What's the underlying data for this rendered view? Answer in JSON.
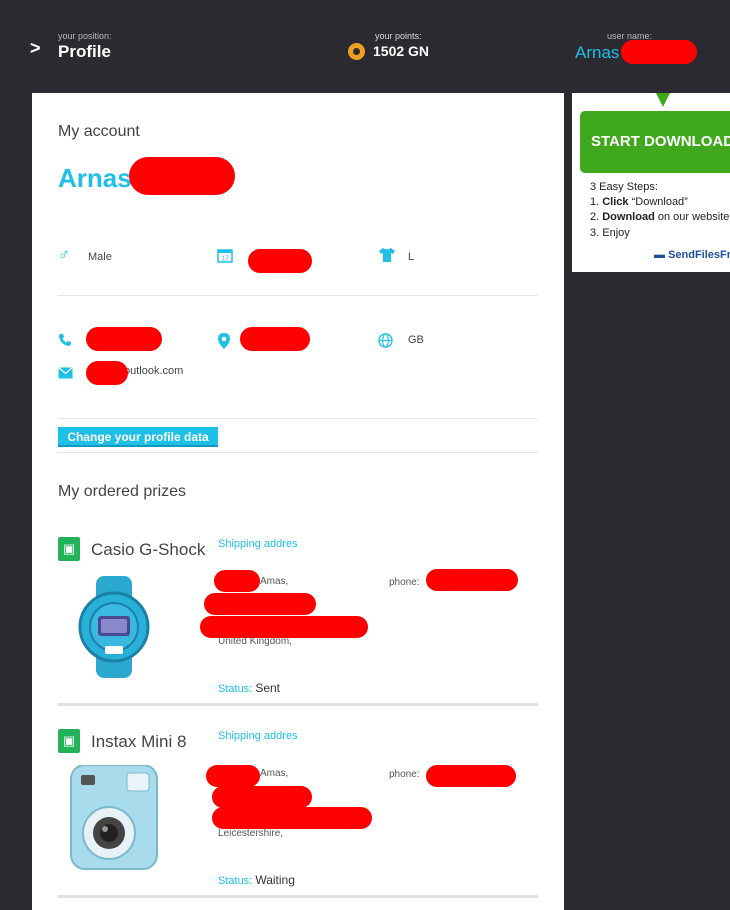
{
  "header": {
    "position_label": "your position:",
    "position_value": "Profile",
    "points_label": "your points:",
    "points_value": "1502 GN",
    "username_label": "user name:",
    "username_value": "Arnas"
  },
  "account": {
    "title": "My account",
    "name": "Arnas",
    "gender": "Male",
    "size": "L",
    "country": "GB",
    "email_suffix": "outlook.com",
    "change_button": "Change your profile data"
  },
  "prizes": {
    "title": "My ordered prizes",
    "items": [
      {
        "name": "Casio G-Shock",
        "shipping_label": "Shipping addres",
        "addr_line1": "Amas,",
        "addr_line4": "United Kingdom,",
        "phone_label": "phone:",
        "status_label": "Status:",
        "status_value": "Sent"
      },
      {
        "name": "Instax Mini 8",
        "shipping_label": "Shipping addres",
        "addr_line1": "Amas,",
        "addr_line4": "Leicestershire,",
        "phone_label": "phone:",
        "status_label": "Status:",
        "status_value": "Waiting"
      }
    ]
  },
  "ad": {
    "button": "START DOWNLOAD",
    "steps_title": "3 Easy Steps:",
    "step1_bold": "Click",
    "step1_rest": "“Download”",
    "step2_bold": "Download",
    "step2_rest": "on our website",
    "step3": "Enjoy",
    "logo": "SendFilesFree"
  }
}
